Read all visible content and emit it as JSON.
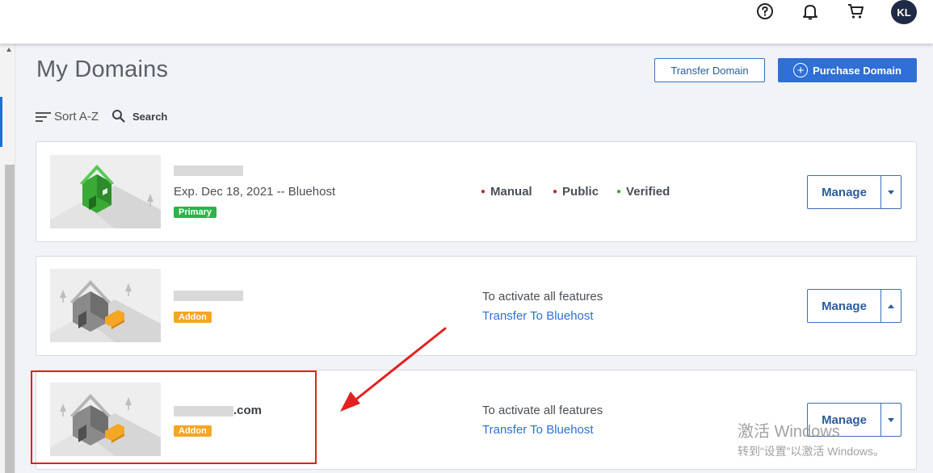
{
  "header": {
    "help_icon": "help-circle-icon",
    "notifications_icon": "bell-icon",
    "cart_icon": "cart-icon",
    "avatar_initials": "KL"
  },
  "page": {
    "title": "My Domains",
    "transfer_button": "Transfer Domain",
    "purchase_button": "Purchase Domain"
  },
  "toolbar": {
    "sort_label": "Sort A-Z",
    "search_label": "Search"
  },
  "domains": [
    {
      "name": "",
      "expiration": "Exp. Dec 18, 2021 -- Bluehost",
      "tag": "Primary",
      "statuses": [
        {
          "label": "Manual",
          "color": "#c0272d"
        },
        {
          "label": "Public",
          "color": "#c0272d"
        },
        {
          "label": "Verified",
          "color": "#3aa935"
        }
      ],
      "manage_label": "Manage"
    },
    {
      "name": "",
      "tag": "Addon",
      "activate_text": "To activate all features",
      "transfer_link": "Transfer To Bluehost",
      "manage_label": "Manage"
    },
    {
      "name_suffix": ".com",
      "tag": "Addon",
      "activate_text": "To activate all features",
      "transfer_link": "Transfer To Bluehost",
      "manage_label": "Manage"
    }
  ],
  "watermark": {
    "line1": "激活 Windows",
    "line2": "转到“设置”以激活 Windows。"
  },
  "colors": {
    "accent": "#2f6fd6",
    "primary_tag": "#2cb34a",
    "addon_tag": "#f5a623",
    "annotation": "#e32020"
  }
}
